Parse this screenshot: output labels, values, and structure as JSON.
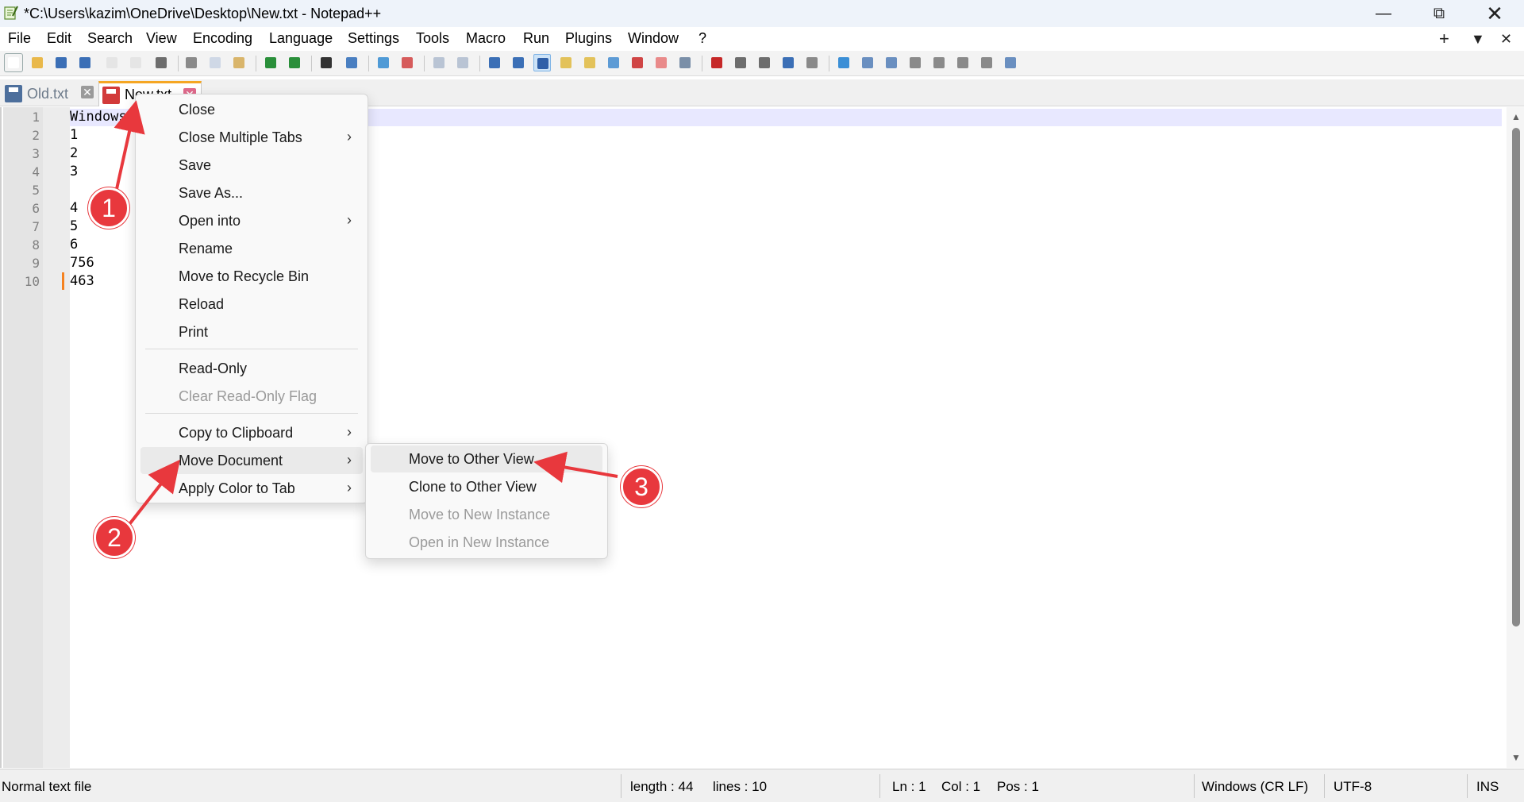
{
  "window": {
    "title": "*C:\\Users\\kazim\\OneDrive\\Desktop\\New.txt - Notepad++",
    "minimize_glyph": "—",
    "maximize_glyph": "⧉",
    "close_glyph": "✕"
  },
  "menubar": {
    "items": [
      "File",
      "Edit",
      "Search",
      "View",
      "Encoding",
      "Language",
      "Settings",
      "Tools",
      "Macro",
      "Run",
      "Plugins",
      "Window",
      "?"
    ],
    "right": {
      "add": "+",
      "dropdown": "▼",
      "close": "✕"
    }
  },
  "tabs": [
    {
      "label": "Old.txt",
      "icon": "save-disk-icon",
      "close": "✕"
    },
    {
      "label": "New.txt",
      "icon": "unsaved-disk-icon",
      "close": "✕"
    }
  ],
  "editor": {
    "line_numbers": [
      "1",
      "2",
      "3",
      "4",
      "5",
      "6",
      "7",
      "8",
      "9",
      "10"
    ],
    "lines": [
      "Windows",
      "1",
      "2",
      "3",
      "",
      "4",
      "5",
      "6",
      "756",
      "463"
    ]
  },
  "status": {
    "filetype": "Normal text file",
    "length": "length : 44",
    "lines": "lines : 10",
    "ln": "Ln : 1",
    "col": "Col : 1",
    "pos": "Pos : 1",
    "eol": "Windows (CR LF)",
    "encoding": "UTF-8",
    "mode": "INS"
  },
  "context_menu": {
    "items": [
      {
        "label": "Close"
      },
      {
        "label": "Close Multiple Tabs",
        "submenu": true
      },
      {
        "label": "Save"
      },
      {
        "label": "Save As..."
      },
      {
        "label": "Open into",
        "submenu": true
      },
      {
        "label": "Rename"
      },
      {
        "label": "Move to Recycle Bin"
      },
      {
        "label": "Reload"
      },
      {
        "label": "Print"
      },
      {
        "label": "Read-Only"
      },
      {
        "label": "Clear Read-Only Flag",
        "disabled": true
      },
      {
        "label": "Copy to Clipboard",
        "submenu": true
      },
      {
        "label": "Move Document",
        "submenu": true,
        "highlighted": true
      },
      {
        "label": "Apply Color to Tab",
        "submenu": true
      }
    ],
    "submenu_arrow": "›"
  },
  "submenu": {
    "items": [
      {
        "label": "Move to Other View",
        "highlighted": true
      },
      {
        "label": "Clone to Other View"
      },
      {
        "label": "Move to New Instance",
        "disabled": true
      },
      {
        "label": "Open in New Instance",
        "disabled": true
      }
    ]
  },
  "annotations": {
    "badges": [
      "1",
      "2",
      "3"
    ],
    "color": "#e8383d"
  },
  "colors": {
    "titlebar": "#eef3fa",
    "current_line": "#e8e8ff",
    "tab_accent": "#f5a623",
    "change_marker": "#f58220"
  }
}
